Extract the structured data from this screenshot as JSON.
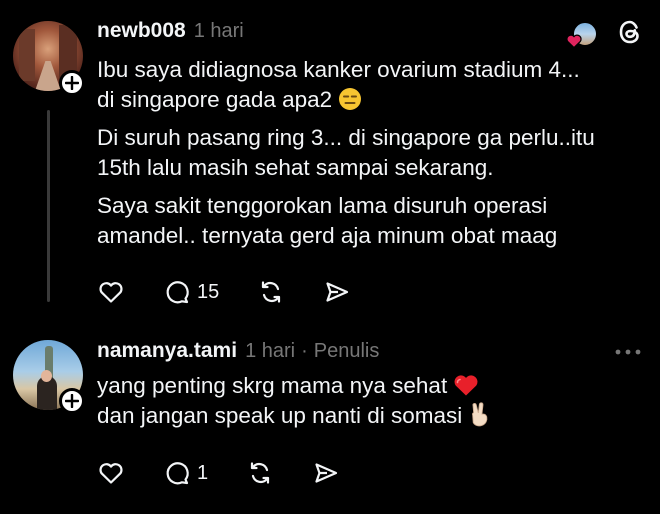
{
  "comments": [
    {
      "username": "newb008",
      "time": "1 hari",
      "paragraphs": [
        [
          "Ibu saya didiagnosa kanker ovarium stadium 4...",
          "di singapore gada apa2"
        ],
        [
          "Di suruh pasang ring 3... di singapore ga perlu..itu",
          "15th lalu masih sehat sampai sekarang."
        ],
        [
          "Saya sakit tenggorokan lama disuruh operasi",
          "amandel.. ternyata gerd aja minum obat maag"
        ]
      ],
      "reply_count": "15",
      "icons": [
        "heart-icon",
        "comment-icon",
        "repost-icon",
        "share-icon",
        "threads-logo-icon"
      ]
    },
    {
      "username": "namanya.tami",
      "time": "1 hari",
      "author_label": "Penulis",
      "lines": [
        "yang penting skrg mama nya sehat",
        "dan jangan speak up nanti di somasi"
      ],
      "reply_count": "1",
      "icons": [
        "heart-icon",
        "comment-icon",
        "repost-icon",
        "share-icon",
        "more-icon"
      ]
    }
  ],
  "colors": {
    "background": "#000000",
    "text": "#f3f5f7",
    "muted": "#777777",
    "heart_red": "#e0245e"
  }
}
